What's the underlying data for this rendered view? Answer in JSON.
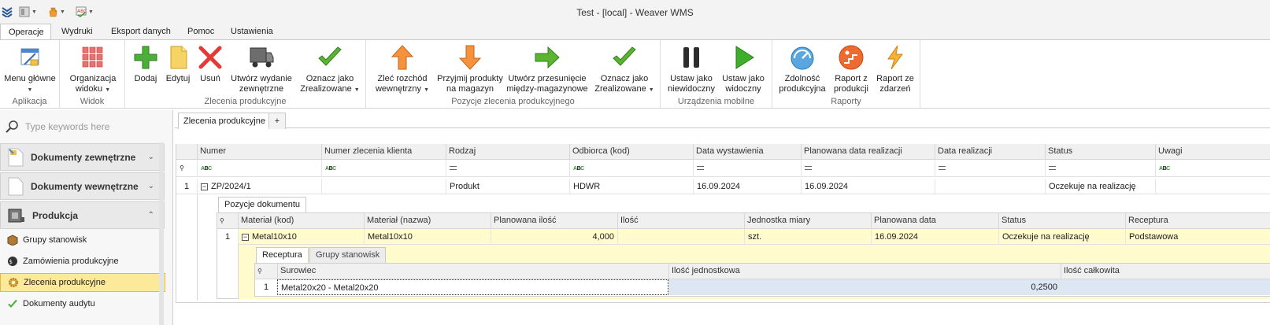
{
  "window": {
    "title": "Test - [local] - Weaver WMS"
  },
  "ribbon_tabs": [
    "Operacje",
    "Wydruki",
    "Eksport danych",
    "Pomoc",
    "Ustawienia"
  ],
  "ribbon": {
    "groups": [
      {
        "caption": "Aplikacja",
        "buttons": [
          {
            "label": "Menu główne",
            "icon": "menu-icon"
          }
        ]
      },
      {
        "caption": "Widok",
        "buttons": [
          {
            "label": "Organizacja widoku",
            "icon": "layout-grid-icon"
          }
        ]
      },
      {
        "caption": "Zlecenia produkcyjne",
        "buttons": [
          {
            "label": "Dodaj",
            "icon": "plus-icon"
          },
          {
            "label": "Edytuj",
            "icon": "document-icon"
          },
          {
            "label": "Usuń",
            "icon": "delete-x-icon"
          },
          {
            "label": "Utwórz wydanie zewnętrzne",
            "icon": "truck-icon"
          },
          {
            "label": "Oznacz jako Zrealizowane",
            "icon": "checkmark-icon"
          }
        ]
      },
      {
        "caption": "Pozycje zlecenia produkcyjnego",
        "buttons": [
          {
            "label": "Zleć rozchód wewnętrzny",
            "icon": "arrow-up-icon"
          },
          {
            "label": "Przyjmij produkty na magazyn",
            "icon": "arrow-down-icon"
          },
          {
            "label": "Utwórz przesunięcie między-magazynowe",
            "icon": "arrow-right-icon"
          },
          {
            "label": "Oznacz jako Zrealizowane",
            "icon": "checkmark-icon"
          }
        ]
      },
      {
        "caption": "Urządzenia mobilne",
        "buttons": [
          {
            "label": "Ustaw jako niewidoczny",
            "icon": "pause-icon"
          },
          {
            "label": "Ustaw jako widoczny",
            "icon": "play-icon"
          }
        ]
      },
      {
        "caption": "Raporty",
        "buttons": [
          {
            "label": "Zdolność produkcyjna",
            "icon": "gauge-icon"
          },
          {
            "label": "Raport z produkcji",
            "icon": "production-report-icon"
          },
          {
            "label": "Raport ze zdarzeń",
            "icon": "lightning-icon"
          }
        ]
      }
    ]
  },
  "nav": {
    "search_placeholder": "Type keywords here",
    "groups": [
      "Dokumenty zewnętrzne",
      "Dokumenty wewnętrzne",
      "Produkcja"
    ],
    "items": [
      "Grupy stanowisk",
      "Zamówienia produkcyjne",
      "Zlecenia produkcyjne",
      "Dokumenty audytu"
    ],
    "selected": "Zlecenia produkcyjne"
  },
  "doc_tab": {
    "label": "Zlecenia produkcyjne",
    "add": "+"
  },
  "main_grid": {
    "columns": [
      "Numer",
      "Numer zlecenia klienta",
      "Rodzaj",
      "Odbiorca (kod)",
      "Data wystawienia",
      "Planowana data realizacji",
      "Data realizacji",
      "Status",
      "Uwagi"
    ],
    "rows": [
      {
        "index": "1",
        "numer": "ZP/2024/1",
        "numer_klienta": "",
        "rodzaj": "Produkt",
        "odbiorca": "HDWR",
        "data_wystawienia": "16.09.2024",
        "planowana_data": "16.09.2024",
        "data_realizacji": "",
        "status": "Oczekuje na realizację",
        "uwagi": ""
      }
    ]
  },
  "detail": {
    "tab": "Pozycje dokumentu",
    "columns": [
      "Materiał (kod)",
      "Materiał (nazwa)",
      "Planowana ilość",
      "Ilość",
      "Jednostka miary",
      "Planowana data",
      "Status",
      "Receptura"
    ],
    "rows": [
      {
        "index": "1",
        "kod": "Metal10x10",
        "nazwa": "Metal10x10",
        "planowana_ilosc": "4,000",
        "ilosc": "",
        "jm": "szt.",
        "planowana_data": "16.09.2024",
        "status": "Oczekuje na realizację",
        "receptura": "Podstawowa"
      }
    ]
  },
  "sub": {
    "tabs": [
      "Receptura",
      "Grupy stanowisk"
    ],
    "columns": [
      "Surowiec",
      "Ilość jednostkowa",
      "Ilość całkowita"
    ],
    "rows": [
      {
        "index": "1",
        "surowiec": "Metal20x20 - Metal20x20",
        "ilosc_jedn": "0,2500",
        "ilosc_calk": ""
      }
    ]
  },
  "colors": {
    "accent_selected": "#fde99a",
    "row_highlight": "#fffbcc",
    "green": "#3fae2a",
    "orange": "#f08a24"
  }
}
